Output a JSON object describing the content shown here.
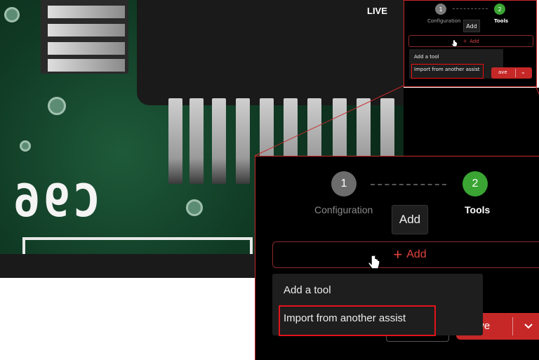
{
  "overlay": {
    "live_label": "LIVE"
  },
  "wizard": {
    "steps": [
      {
        "number": "1",
        "label": "Configuration",
        "state": "inactive"
      },
      {
        "number": "2",
        "label": "Tools",
        "state": "active"
      }
    ],
    "tooltip": "Add",
    "add_button_label": "Add",
    "menu": {
      "items": [
        {
          "label": "Add a tool"
        },
        {
          "label": "Import from another assist"
        }
      ]
    },
    "save_label": "ave"
  },
  "colors": {
    "accent_red": "#c62828",
    "step_active": "#3aa533",
    "step_inactive": "#6c6c6c",
    "highlight": "#e0141a"
  },
  "icons": [
    "plus-icon",
    "chevron-down-icon",
    "hand-pointer-icon"
  ]
}
